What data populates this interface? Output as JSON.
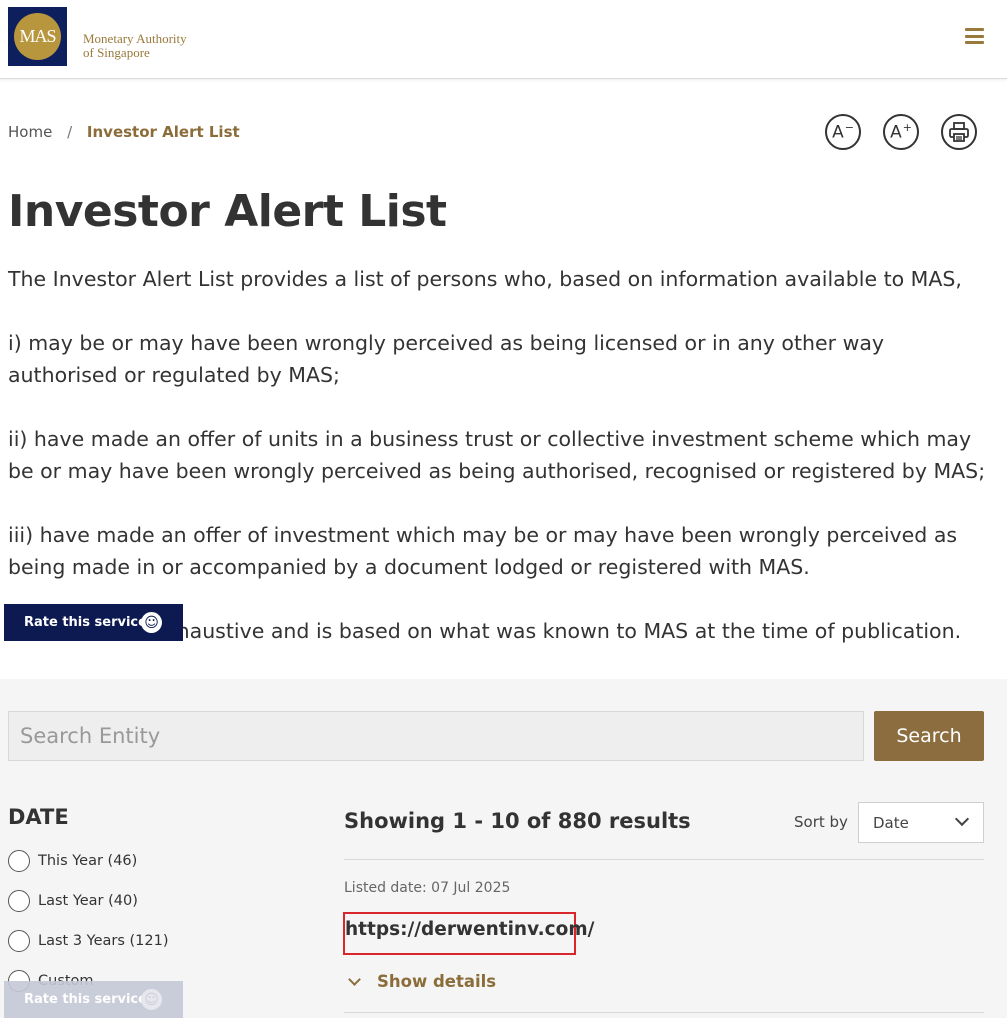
{
  "header": {
    "logo_mark": "MAS",
    "logo_line1": "Monetary Authority",
    "logo_line2": "of Singapore"
  },
  "breadcrumb": {
    "home": "Home",
    "separator": "/",
    "current": "Investor Alert List"
  },
  "tools": {
    "decrease_font": "A",
    "decrease_sup": "−",
    "increase_font": "A",
    "increase_sup": "+"
  },
  "page": {
    "title": "Investor Alert List",
    "intro_lead": "The Investor Alert List provides a list of persons who, based on information available to MAS,",
    "intro_i": "i) may be or may have been wrongly perceived as being licensed or in any other way authorised or regulated by MAS;",
    "intro_ii": "ii) have made an offer of units in a business trust or collective investment scheme which may be or may have been wrongly perceived as being authorised, recognised or registered by MAS;",
    "intro_iii": "iii) have made an offer of investment which may be or may have been wrongly perceived as being made in or accompanied by a document lodged or registered with MAS.",
    "intro_tail": "The list is not exhaustive and is based on what was known to MAS at the time of publication."
  },
  "rate_service": {
    "label": "Rate this service",
    "icon": "smiley-icon"
  },
  "search": {
    "placeholder": "Search Entity",
    "button_label": "Search"
  },
  "filter": {
    "title": "DATE",
    "options": [
      {
        "label": "This Year (46)"
      },
      {
        "label": "Last Year (40)"
      },
      {
        "label": "Last 3 Years (121)"
      },
      {
        "label": "Custom"
      }
    ]
  },
  "results": {
    "count_text": "Showing 1 - 10 of 880 results",
    "sort_label": "Sort by",
    "sort_value": "Date",
    "items": [
      {
        "listed_date": "Listed date: 07 Jul 2025",
        "name": "https://derwentinv.com/",
        "show_details": "Show details"
      }
    ]
  },
  "colors": {
    "brand_navy": "#0d1f5c",
    "brand_gold": "#b8963e",
    "accent_brown": "#8b6d3f",
    "highlight_red": "#d9262c"
  }
}
